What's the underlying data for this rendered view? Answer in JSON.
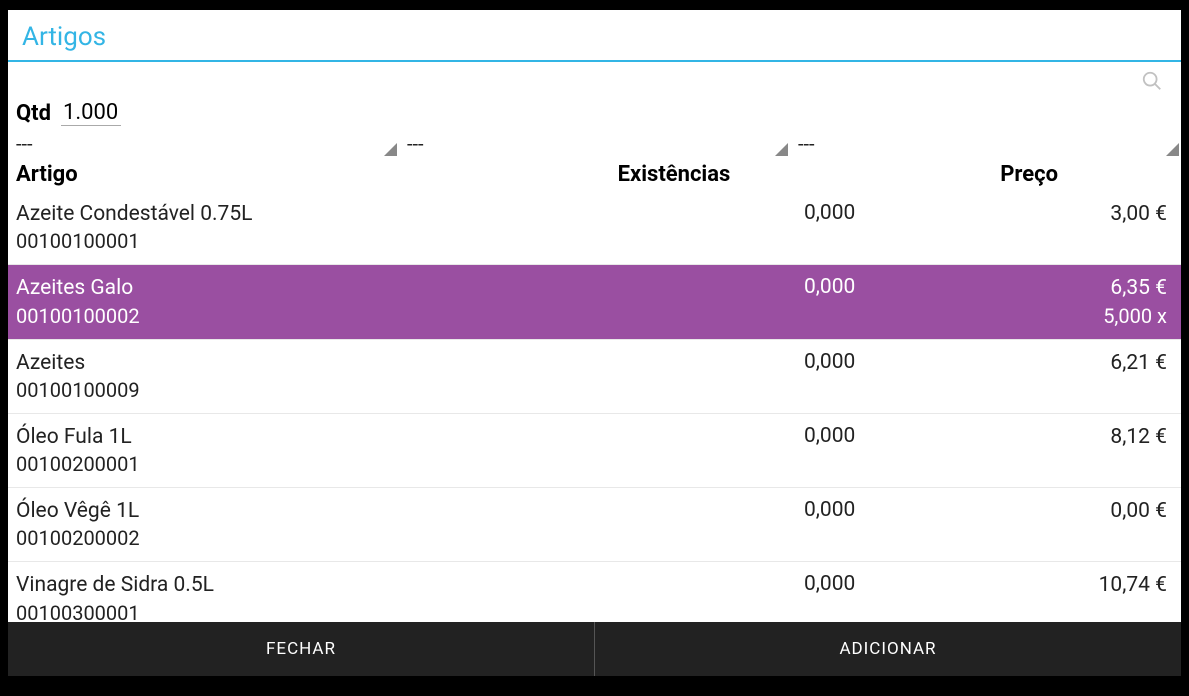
{
  "dialog": {
    "title": "Artigos"
  },
  "qtd": {
    "label": "Qtd",
    "value": "1.000"
  },
  "filters": [
    {
      "value": "---"
    },
    {
      "value": "---"
    },
    {
      "value": "---"
    }
  ],
  "table": {
    "headers": {
      "artigo": "Artigo",
      "existencias": "Existências",
      "preco": "Preço"
    }
  },
  "items": [
    {
      "name": "Azeite Condestável 0.75L",
      "code": "00100100001",
      "stock": "0,000",
      "price": "3,00 €",
      "price_sub": "",
      "selected": false
    },
    {
      "name": "Azeites Galo",
      "code": "00100100002",
      "stock": "0,000",
      "price": "6,35 €",
      "price_sub": "5,000 x",
      "selected": true
    },
    {
      "name": "Azeites",
      "code": "00100100009",
      "stock": "0,000",
      "price": "6,21 €",
      "price_sub": "",
      "selected": false
    },
    {
      "name": "Óleo Fula 1L",
      "code": "00100200001",
      "stock": "0,000",
      "price": "8,12 €",
      "price_sub": "",
      "selected": false
    },
    {
      "name": "Óleo Vêgê 1L",
      "code": "00100200002",
      "stock": "0,000",
      "price": "0,00 €",
      "price_sub": "",
      "selected": false
    },
    {
      "name": "Vinagre de Sidra 0.5L",
      "code": "00100300001",
      "stock": "0,000",
      "price": "10,74 €",
      "price_sub": "",
      "selected": false
    }
  ],
  "footer": {
    "close": "FECHAR",
    "add": "ADICIONAR"
  }
}
